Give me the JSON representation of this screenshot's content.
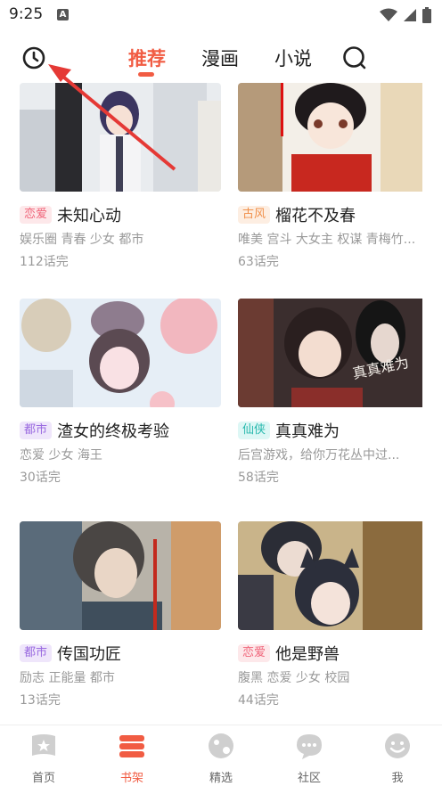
{
  "status": {
    "time": "9:25",
    "a_badge": "A"
  },
  "tabs": [
    {
      "label": "推荐",
      "active": true
    },
    {
      "label": "漫画",
      "active": false
    },
    {
      "label": "小说",
      "active": false
    }
  ],
  "cards": [
    {
      "tag": "恋爱",
      "title": "未知心动",
      "genres": "娱乐圈 青春 少女 都市",
      "eps": "112话完"
    },
    {
      "tag": "古风",
      "title": "榴花不及春",
      "genres": "唯美 宫斗 大女主 权谋 青梅竹...",
      "eps": "63话完"
    },
    {
      "tag": "都市",
      "title": "渣女的终极考验",
      "genres": "恋爱 少女 海王",
      "eps": "30话完"
    },
    {
      "tag": "仙侠",
      "title": "真真难为",
      "genres": "后宫游戏，给你万花丛中过...",
      "eps": "58话完"
    },
    {
      "tag": "都市",
      "title": "传国功匠",
      "genres": "励志 正能量 都市",
      "eps": "13话完"
    },
    {
      "tag": "恋爱",
      "title": "他是野兽",
      "genres": "腹黑 恋爱 少女 校园",
      "eps": "44话完"
    }
  ],
  "cover_art": {
    "cover_4_text": "真真难为"
  },
  "bottom_nav": [
    {
      "label": "首页",
      "active": false
    },
    {
      "label": "书架",
      "active": true
    },
    {
      "label": "精选",
      "active": false
    },
    {
      "label": "社区",
      "active": false
    },
    {
      "label": "我",
      "active": false
    }
  ],
  "colors": {
    "accent": "#f15c43",
    "tag_pink": "#f0657a",
    "tag_orange": "#f0904b",
    "tag_purple": "#9a6ae0",
    "tag_teal": "#27b8ad",
    "annotation": "#e53935"
  },
  "icons": [
    "clock-icon",
    "search-icon",
    "wifi-icon",
    "signal-icon",
    "battery-icon",
    "home-icon",
    "bookshelf-icon",
    "explore-icon",
    "community-icon",
    "profile-icon"
  ]
}
